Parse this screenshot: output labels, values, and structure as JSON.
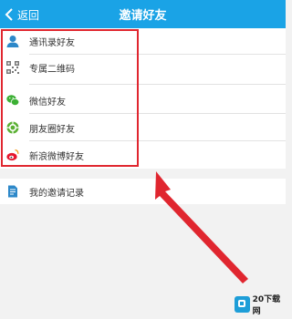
{
  "header": {
    "back_label": "返回",
    "title": "邀请好友"
  },
  "invite_options": [
    {
      "label": "通讯录好友",
      "icon": "contact-icon"
    },
    {
      "label": "专属二维码",
      "icon": "qr-code-icon"
    },
    {
      "label": "微信好友",
      "icon": "wechat-icon"
    },
    {
      "label": "朋友圈好友",
      "icon": "moments-icon"
    },
    {
      "label": "新浪微博好友",
      "icon": "weibo-icon"
    }
  ],
  "records": {
    "label": "我的邀请记录",
    "icon": "document-icon"
  },
  "watermark": {
    "text": "20下载网"
  },
  "colors": {
    "header": "#1aa3e6",
    "highlight": "#e0262f",
    "wechat": "#3cb034",
    "moments": "#5ab032",
    "weibo": "#e6162d"
  }
}
